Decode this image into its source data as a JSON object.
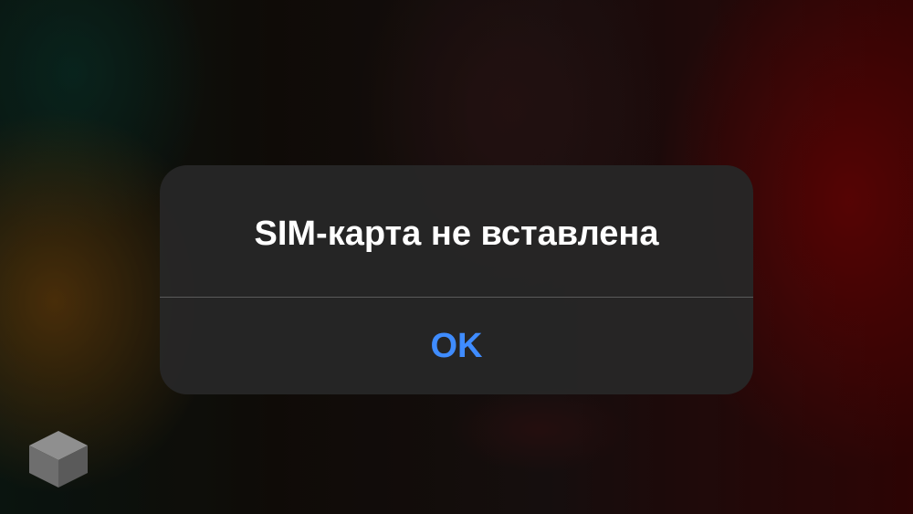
{
  "alert": {
    "title": "SIM-карта не вставлена",
    "button_label": "OK"
  },
  "colors": {
    "alert_background": "#262626",
    "button_text": "#3f8cff",
    "title_text": "#ffffff"
  },
  "icons": {
    "watermark": "cube-logo-icon"
  }
}
